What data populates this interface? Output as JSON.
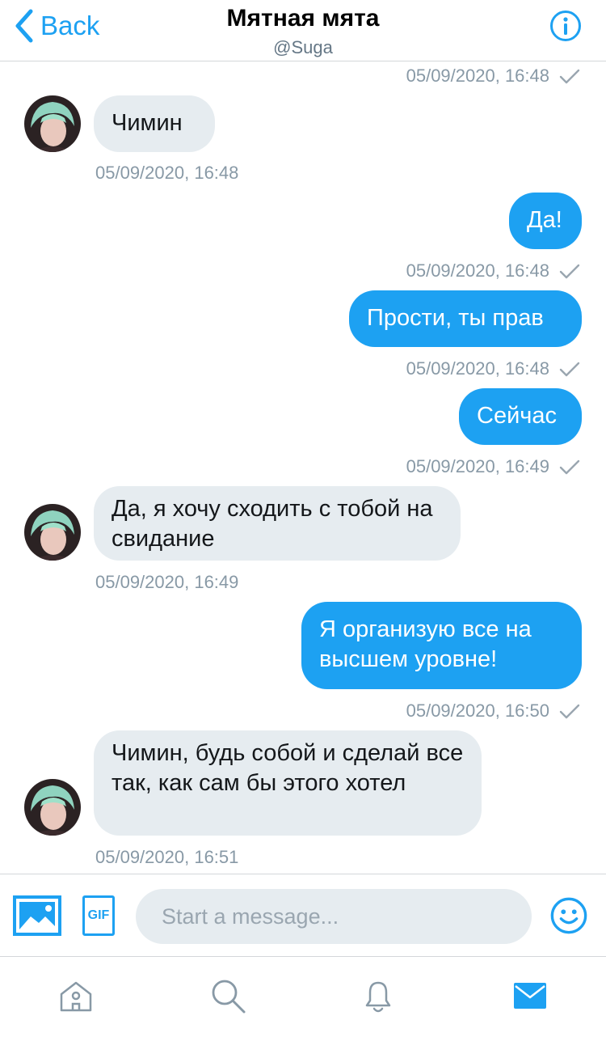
{
  "header": {
    "back_label": "Back",
    "title": "Мятная мята",
    "handle": "@Suga",
    "back_icon": "chevron-left-icon",
    "info_icon": "info-icon"
  },
  "colors": {
    "accent": "#1da1f2",
    "incoming_bubble": "#e6ecf0",
    "timestamp": "#8899a6"
  },
  "conversation": {
    "top_timestamp": "05/09/2020, 16:48",
    "messages": [
      {
        "direction": "in",
        "text": "Чимин",
        "time": "05/09/2020, 16:48"
      },
      {
        "direction": "out",
        "text": "Да!",
        "time": "05/09/2020, 16:48"
      },
      {
        "direction": "out",
        "text": "Прости, ты прав",
        "time": "05/09/2020, 16:48"
      },
      {
        "direction": "out",
        "text": "Сейчас",
        "time": "05/09/2020, 16:49"
      },
      {
        "direction": "in",
        "text": "Да, я хочу сходить с тобой на свидание",
        "time": "05/09/2020, 16:49"
      },
      {
        "direction": "out",
        "text": "Я организую все на высшем уровне!",
        "time": "05/09/2020, 16:50"
      },
      {
        "direction": "in",
        "text": "Чимин, будь собой и сделай все так, как сам бы этого хотел",
        "time": "05/09/2020, 16:51"
      }
    ]
  },
  "composer": {
    "placeholder": "Start a message...",
    "gif_label": "GIF",
    "media_icon": "image-icon",
    "emoji_icon": "emoji-icon"
  },
  "tabs": [
    {
      "name": "home",
      "icon": "home-icon"
    },
    {
      "name": "search",
      "icon": "search-icon"
    },
    {
      "name": "notifications",
      "icon": "bell-icon"
    },
    {
      "name": "messages",
      "icon": "mail-icon",
      "active": true
    }
  ]
}
